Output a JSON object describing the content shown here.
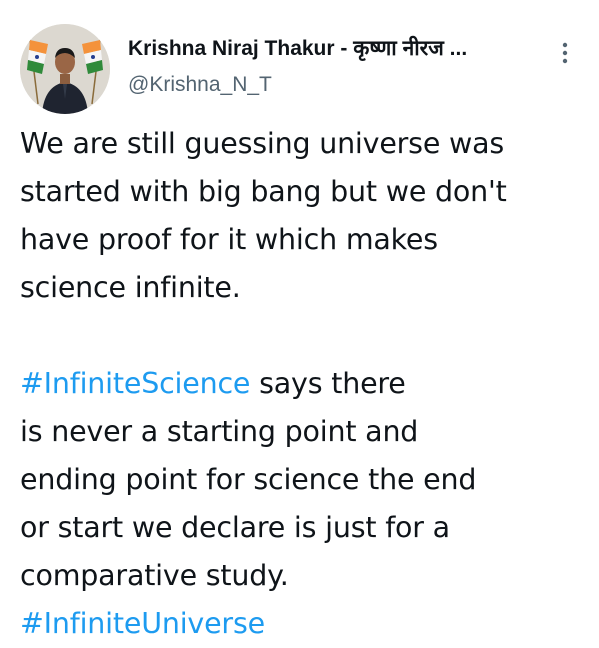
{
  "author": {
    "display_name": "Krishna Niraj Thakur - कृष्णा नीरज ...",
    "handle": "@Krishna_N_T",
    "avatar": "profile-photo-with-indian-flags"
  },
  "menu": {
    "icon": "more-vertical-icon"
  },
  "tweet": {
    "paragraph1": [
      "We are still guessing universe was",
      "started with big bang but we don't",
      "have proof for it which makes",
      "science infinite."
    ],
    "hashtag1": "#InfiniteScience",
    "line5_rest": " says there",
    "paragraph2": [
      "is never a starting point and",
      "ending point for science the end",
      "or start we declare is just for a",
      "comparative study."
    ],
    "hashtag2": "#InfiniteUniverse"
  },
  "colors": {
    "text": "#0f1419",
    "secondary": "#536471",
    "link": "#1d9bf0"
  }
}
